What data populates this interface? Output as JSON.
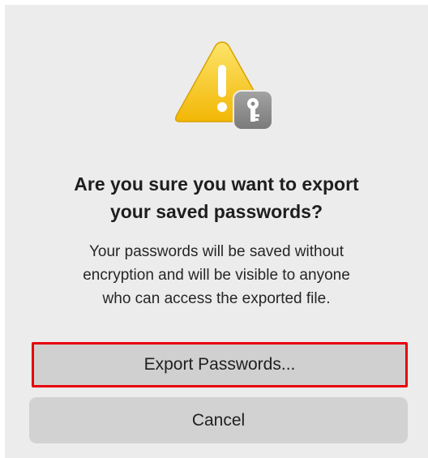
{
  "dialog": {
    "title_line1": "Are you sure you want to export",
    "title_line2": "your saved passwords?",
    "message_line1": "Your passwords will be saved without",
    "message_line2": "encryption and will be visible to anyone",
    "message_line3": "who can access the exported file.",
    "icon": "warning-triangle-with-key-badge"
  },
  "buttons": {
    "export_label": "Export Passwords...",
    "cancel_label": "Cancel"
  },
  "colors": {
    "dialog_background": "#ececec",
    "warning_yellow": "#f5c518",
    "badge_gray": "#8a8a8a",
    "button_gray": "#d2d2d2",
    "highlight_red": "#e8000d"
  }
}
